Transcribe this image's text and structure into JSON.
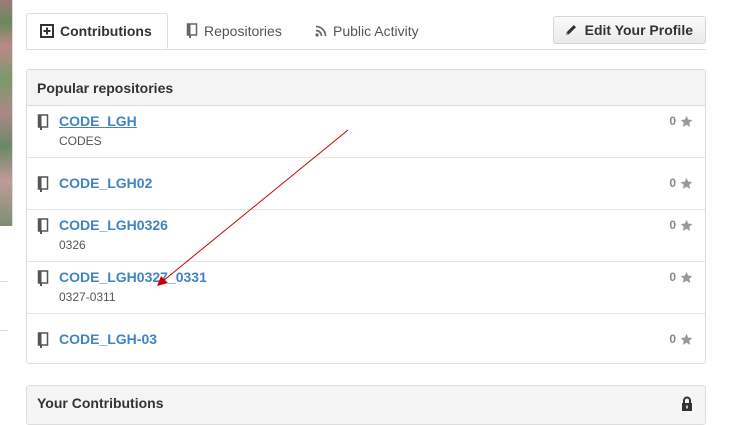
{
  "tabs": [
    {
      "label": "Contributions",
      "icon": "plus-square-icon",
      "active": true
    },
    {
      "label": "Repositories",
      "icon": "repo-book-icon",
      "active": false
    },
    {
      "label": "Public Activity",
      "icon": "rss-icon",
      "active": false
    }
  ],
  "edit_profile": {
    "label": "Edit Your Profile",
    "icon": "pencil-icon"
  },
  "popular": {
    "title": "Popular repositories",
    "repos": [
      {
        "name": "CODE_LGH",
        "description": "CODES",
        "stars": "0"
      },
      {
        "name": "CODE_LGH02",
        "description": "",
        "stars": "0"
      },
      {
        "name": "CODE_LGH0326",
        "description": "0326",
        "stars": "0"
      },
      {
        "name": "CODE_LGH0327_0331",
        "description": "0327-0311",
        "stars": "0"
      },
      {
        "name": "CODE_LGH-03",
        "description": "",
        "stars": "0"
      }
    ]
  },
  "contributions": {
    "title": "Your Contributions",
    "icon": "lock-icon"
  },
  "colors": {
    "link": "#4183c4",
    "annotation_arrow": "#cc0000"
  }
}
